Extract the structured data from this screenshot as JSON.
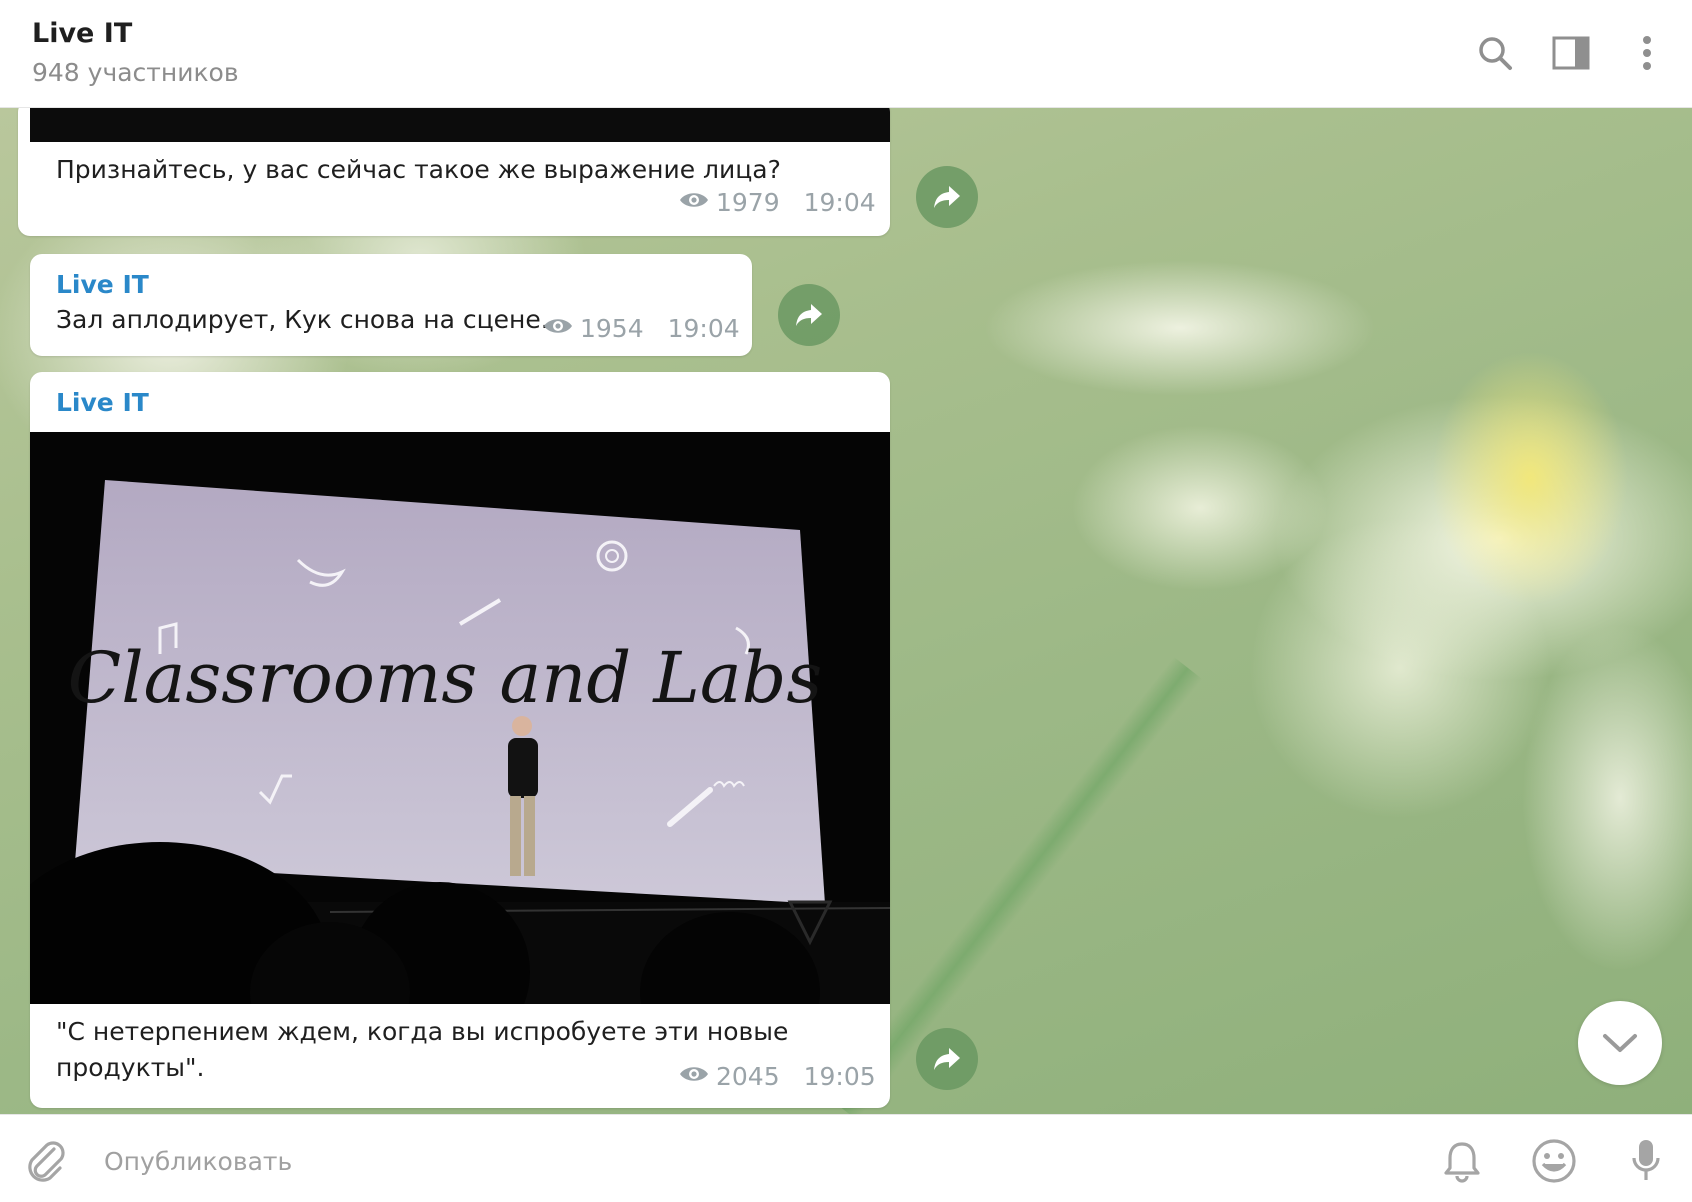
{
  "header": {
    "title": "Live IT",
    "subtitle": "948 участников",
    "icons": [
      "search-icon",
      "sidebar-toggle-icon",
      "more-vertical-icon"
    ]
  },
  "messages": [
    {
      "text": "Признайтесь, у вас сейчас такое же выражение лица?",
      "views": "1979",
      "time": "19:04"
    },
    {
      "author": "Live IT",
      "text": "Зал аплодирует, Кук снова на сцене.",
      "views": "1954",
      "time": "19:04"
    },
    {
      "author": "Live IT",
      "photo_caption": "Classrooms and Labs",
      "text_line1": "\"С нетерпением ждем, когда вы испробуете эти новые",
      "text_line2": "продукты\".",
      "views": "2045",
      "time": "19:05"
    }
  ],
  "footer": {
    "placeholder": "Опубликовать",
    "icons": [
      "attach-icon",
      "bell-icon",
      "emoji-icon",
      "microphone-icon"
    ]
  },
  "colors": {
    "accent": "#2a88c9",
    "forward_button": "#6f9a66",
    "meta_text": "#9aa3a8"
  }
}
